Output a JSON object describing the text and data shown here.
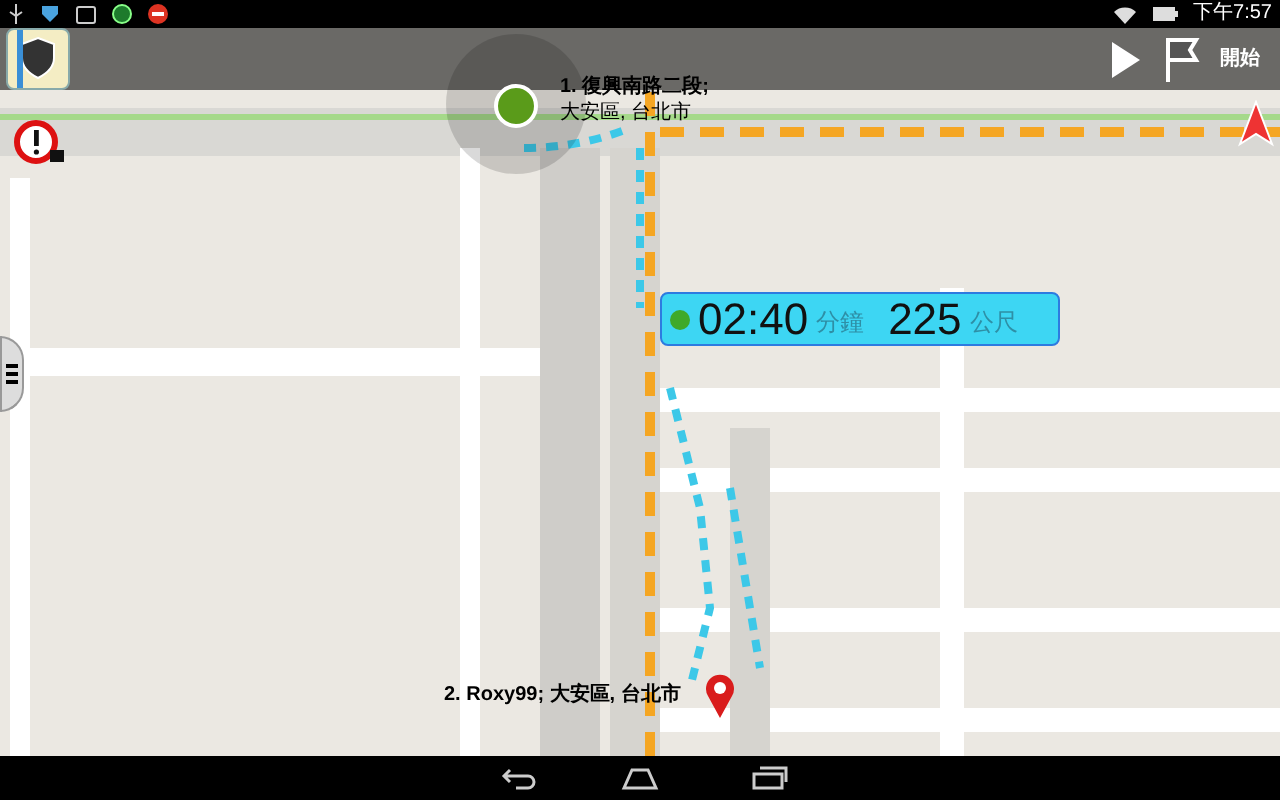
{
  "status_bar": {
    "time": "下午7:57"
  },
  "top_bar": {
    "start_label": "開始"
  },
  "waypoints": [
    {
      "lines": [
        "1. 復興南路二段;",
        "大安區, 台北市"
      ]
    },
    {
      "lines": [
        "2. Roxy99; 大安區, 台北市"
      ]
    }
  ],
  "eta": {
    "time": "02:40",
    "time_unit": "分鐘",
    "distance": "225",
    "distance_unit": "公尺"
  }
}
